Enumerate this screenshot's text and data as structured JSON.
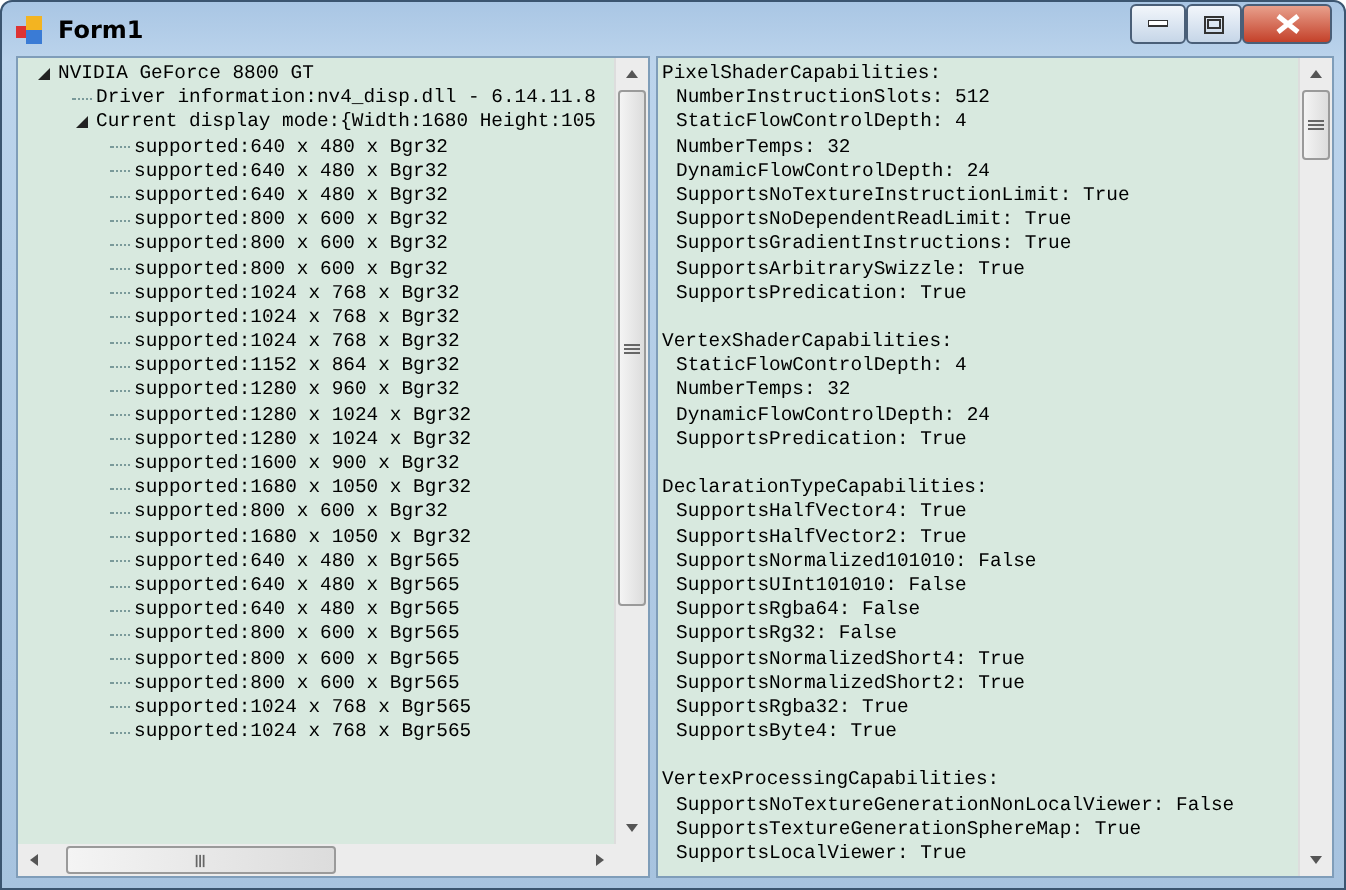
{
  "window": {
    "title": "Form1"
  },
  "tree": [
    {
      "label": "NVIDIA GeForce 8800 GT",
      "expanded": true,
      "children": [
        {
          "label": "Driver information:nv4_disp.dll - 6.14.11.8"
        },
        {
          "label": "Current display mode:{Width:1680 Height:105",
          "expanded": true,
          "children": [
            {
              "label": "supported:640 x 480 x Bgr32"
            },
            {
              "label": "supported:640 x 480 x Bgr32"
            },
            {
              "label": "supported:640 x 480 x Bgr32"
            },
            {
              "label": "supported:800 x 600 x Bgr32"
            },
            {
              "label": "supported:800 x 600 x Bgr32"
            },
            {
              "label": "supported:800 x 600 x Bgr32"
            },
            {
              "label": "supported:1024 x 768 x Bgr32"
            },
            {
              "label": "supported:1024 x 768 x Bgr32"
            },
            {
              "label": "supported:1024 x 768 x Bgr32"
            },
            {
              "label": "supported:1152 x 864 x Bgr32"
            },
            {
              "label": "supported:1280 x 960 x Bgr32"
            },
            {
              "label": "supported:1280 x 1024 x Bgr32"
            },
            {
              "label": "supported:1280 x 1024 x Bgr32"
            },
            {
              "label": "supported:1600 x 900 x Bgr32"
            },
            {
              "label": "supported:1680 x 1050 x Bgr32"
            },
            {
              "label": "supported:800 x 600 x Bgr32"
            },
            {
              "label": "supported:1680 x 1050 x Bgr32"
            },
            {
              "label": "supported:640 x 480 x Bgr565"
            },
            {
              "label": "supported:640 x 480 x Bgr565"
            },
            {
              "label": "supported:640 x 480 x Bgr565"
            },
            {
              "label": "supported:800 x 600 x Bgr565"
            },
            {
              "label": "supported:800 x 600 x Bgr565"
            },
            {
              "label": "supported:800 x 600 x Bgr565"
            },
            {
              "label": "supported:1024 x 768 x Bgr565"
            },
            {
              "label": "supported:1024 x 768 x Bgr565"
            }
          ]
        }
      ]
    }
  ],
  "details": [
    {
      "title": "PixelShaderCapabilities:",
      "lines": [
        "NumberInstructionSlots: 512",
        "StaticFlowControlDepth: 4",
        "NumberTemps: 32",
        "DynamicFlowControlDepth: 24",
        "SupportsNoTextureInstructionLimit: True",
        "SupportsNoDependentReadLimit: True",
        "SupportsGradientInstructions: True",
        "SupportsArbitrarySwizzle: True",
        "SupportsPredication: True"
      ]
    },
    {
      "title": "VertexShaderCapabilities:",
      "lines": [
        "StaticFlowControlDepth: 4",
        "NumberTemps: 32",
        "DynamicFlowControlDepth: 24",
        "SupportsPredication: True"
      ]
    },
    {
      "title": "DeclarationTypeCapabilities:",
      "lines": [
        "SupportsHalfVector4: True",
        "SupportsHalfVector2: True",
        "SupportsNormalized101010: False",
        "SupportsUInt101010: False",
        "SupportsRgba64: False",
        "SupportsRg32: False",
        "SupportsNormalizedShort4: True",
        "SupportsNormalizedShort2: True",
        "SupportsRgba32: True",
        "SupportsByte4: True"
      ]
    },
    {
      "title": "VertexProcessingCapabilities:",
      "lines": [
        "SupportsNoTextureGenerationNonLocalViewer: False",
        "SupportsTextureGenerationSphereMap: True",
        "SupportsLocalViewer: True"
      ]
    }
  ]
}
